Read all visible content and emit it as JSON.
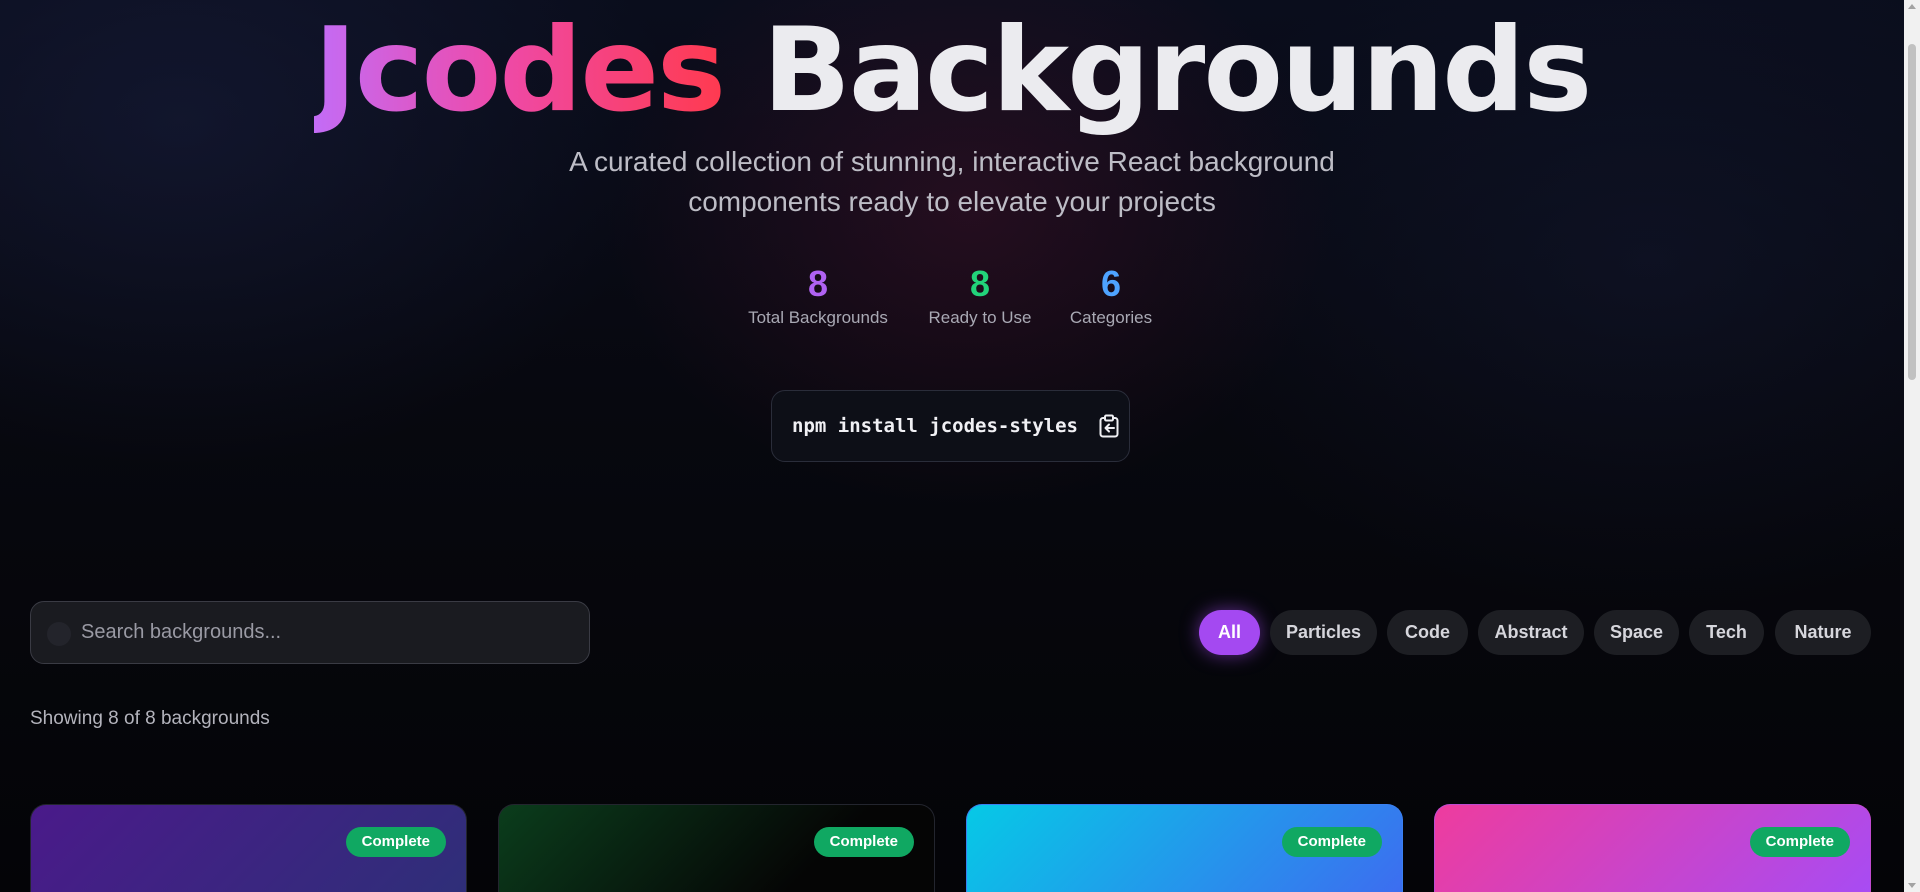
{
  "hero": {
    "title_accent": "Jcodes",
    "title_rest": "Backgrounds",
    "subtitle": "A curated collection of stunning, interactive React background components ready to elevate your projects"
  },
  "stats": [
    {
      "value": "8",
      "label": "Total Backgrounds",
      "color": "#b062f2"
    },
    {
      "value": "8",
      "label": "Ready to Use",
      "color": "#22d37a"
    },
    {
      "value": "6",
      "label": "Categories",
      "color": "#4ea3ff"
    }
  ],
  "install": {
    "command": "npm install jcodes-styles",
    "icon": "clipboard-copy-icon"
  },
  "search": {
    "placeholder": "Search backgrounds...",
    "value": "",
    "icon": "search-icon"
  },
  "filters": {
    "selected": "All",
    "items": [
      "All",
      "Particles",
      "Code",
      "Abstract",
      "Space",
      "Tech",
      "Nature"
    ]
  },
  "results": {
    "text": "Showing 8 of 8 backgrounds"
  },
  "cards": [
    {
      "status": "Complete",
      "gradient": [
        "#4a1a8a",
        "#2e2f78"
      ]
    },
    {
      "status": "Complete",
      "gradient": [
        "#0b3d1c",
        "#050505"
      ]
    },
    {
      "status": "Complete",
      "gradient": [
        "#06c9e6",
        "#3e6bf0"
      ]
    },
    {
      "status": "Complete",
      "gradient": [
        "#ee3c9e",
        "#a64cf5"
      ]
    }
  ],
  "colors": {
    "accent": "#a449f1",
    "badge": "#10a862"
  }
}
